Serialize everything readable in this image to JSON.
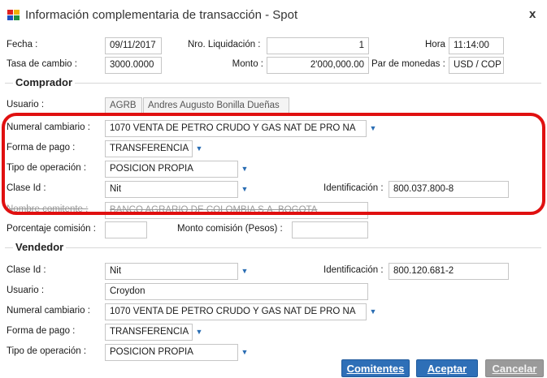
{
  "window": {
    "title": "Información complementaria de transacción - Spot",
    "close_label": "x"
  },
  "header": {
    "fecha_label": "Fecha :",
    "fecha_value": "09/11/2017",
    "liquidacion_label": "Nro. Liquidación :",
    "liquidacion_value": "1",
    "hora_label": "Hora :",
    "hora_value": "11:14:00",
    "tasa_label": "Tasa de cambio :",
    "tasa_value": "3000.0000",
    "monto_label": "Monto :",
    "monto_value": "2'000,000.00",
    "par_label": "Par de monedas :",
    "par_value": "USD / COP"
  },
  "comprador": {
    "section": "Comprador",
    "usuario_label": "Usuario :",
    "usuario_code": "AGRB",
    "usuario_name": "Andres Augusto Bonilla Dueñas",
    "numeral_label": "Numeral cambiario :",
    "numeral_value": "1070  VENTA DE PETRO CRUDO Y GAS NAT DE PRO NA",
    "forma_label": "Forma de pago :",
    "forma_value": "TRANSFERENCIA",
    "tipo_label": "Tipo de operación :",
    "tipo_value": "POSICION PROPIA",
    "clase_label": "Clase Id :",
    "clase_value": "Nit",
    "ident_label": "Identificación :",
    "ident_value": "800.037.800-8",
    "comitente_label": "Nombre comitente :",
    "comitente_value": "BANCO AGRARIO DE COLOMBIA S.A.  BOGOTA",
    "porcentaje_label": "Porcentaje comisión :",
    "porcentaje_value": "",
    "monto_com_label": "Monto comisión (Pesos) :",
    "monto_com_value": ""
  },
  "vendedor": {
    "section": "Vendedor",
    "clase_label": "Clase Id :",
    "clase_value": "Nit",
    "ident_label": "Identificación :",
    "ident_value": "800.120.681-2",
    "usuario_label": "Usuario :",
    "usuario_value": "Croydon",
    "numeral_label": "Numeral cambiario :",
    "numeral_value": "1070  VENTA DE PETRO CRUDO Y GAS NAT DE PRO NA",
    "forma_label": "Forma de pago :",
    "forma_value": "TRANSFERENCIA",
    "tipo_label": "Tipo de operación :",
    "tipo_value": "POSICION PROPIA"
  },
  "buttons": {
    "comitentes": "Comitentes",
    "aceptar": "Aceptar",
    "cancelar": "Cancelar"
  },
  "colors": {
    "accent": "#2e6fb7",
    "highlight": "#e01010",
    "disabled_button": "#9a9a9a"
  },
  "icons": {
    "app": "app-logo-icon",
    "dropdown": "dropdown-arrow-icon",
    "close": "close-icon"
  }
}
